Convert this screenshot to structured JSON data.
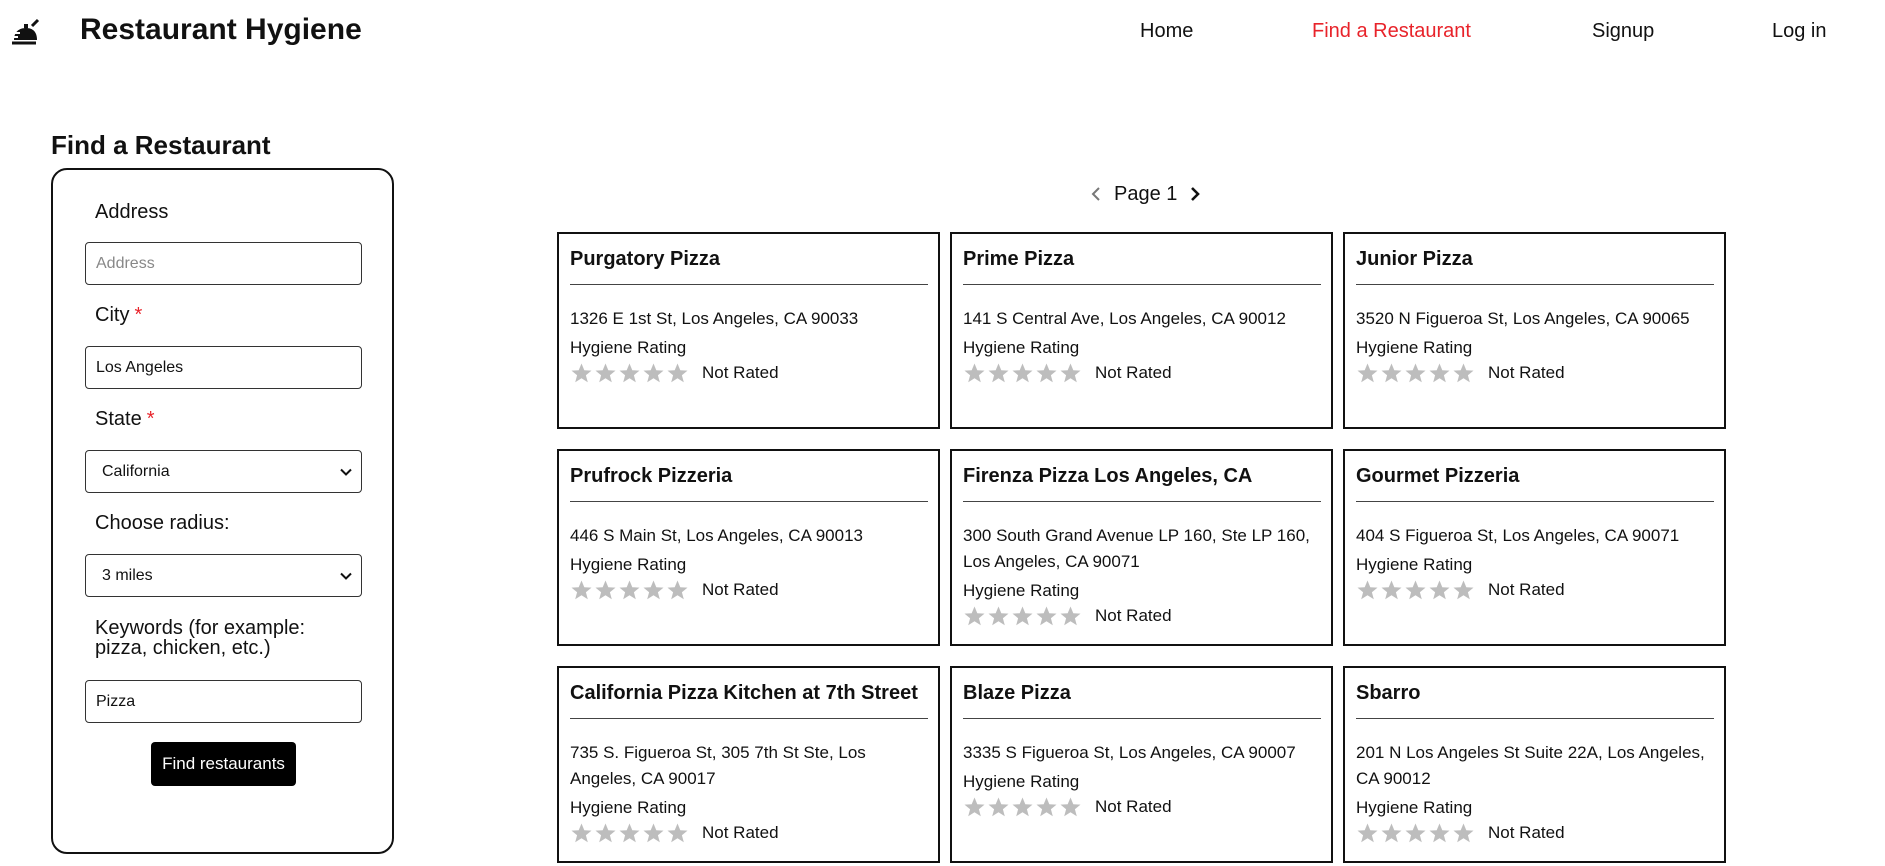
{
  "brand": {
    "title": "Restaurant Hygiene",
    "logo_icon": "restaurant-cloche-icon"
  },
  "nav": {
    "items": [
      {
        "label": "Home",
        "active": false
      },
      {
        "label": "Find a Restaurant",
        "active": true
      },
      {
        "label": "Signup",
        "active": false
      },
      {
        "label": "Log in",
        "active": false
      }
    ]
  },
  "colors": {
    "accent": "#e8232a",
    "text": "#111111",
    "star_empty": "#bdbdbd",
    "button_bg": "#000000"
  },
  "search": {
    "page_title": "Find a Restaurant",
    "address": {
      "label": "Address",
      "placeholder": "Address",
      "value": ""
    },
    "city": {
      "label": "City",
      "required_mark": "*",
      "value": "Los Angeles"
    },
    "state": {
      "label": "State",
      "required_mark": "*",
      "value": "California"
    },
    "radius": {
      "label": "Choose radius:",
      "value": "3 miles"
    },
    "keywords": {
      "label": "Keywords (for example: pizza, chicken, etc.)",
      "value": "Pizza"
    },
    "submit_label": "Find restaurants"
  },
  "pagination": {
    "label": "Page 1",
    "prev_icon": "chevron-left-icon",
    "next_icon": "chevron-right-icon"
  },
  "results": [
    {
      "name": "Purgatory Pizza",
      "address": "1326 E 1st St, Los Angeles, CA 90033",
      "rating_label": "Hygiene Rating",
      "stars": 0,
      "rating_text": "Not Rated"
    },
    {
      "name": "Prime Pizza",
      "address": "141 S Central Ave, Los Angeles, CA 90012",
      "rating_label": "Hygiene Rating",
      "stars": 0,
      "rating_text": "Not Rated"
    },
    {
      "name": "Junior Pizza",
      "address": "3520 N Figueroa St, Los Angeles, CA 90065",
      "rating_label": "Hygiene Rating",
      "stars": 0,
      "rating_text": "Not Rated"
    },
    {
      "name": "Prufrock Pizzeria",
      "address": "446 S Main St, Los Angeles, CA 90013",
      "rating_label": "Hygiene Rating",
      "stars": 0,
      "rating_text": "Not Rated"
    },
    {
      "name": "Firenza Pizza Los Angeles, CA",
      "address": "300 South Grand Avenue LP 160, Ste LP 160, Los Angeles, CA 90071",
      "rating_label": "Hygiene Rating",
      "stars": 0,
      "rating_text": "Not Rated"
    },
    {
      "name": "Gourmet Pizzeria",
      "address": "404 S Figueroa St, Los Angeles, CA 90071",
      "rating_label": "Hygiene Rating",
      "stars": 0,
      "rating_text": "Not Rated"
    },
    {
      "name": "California Pizza Kitchen at 7th Street",
      "address": "735 S. Figueroa St, 305 7th St Ste, Los Angeles, CA 90017",
      "rating_label": "Hygiene Rating",
      "stars": 0,
      "rating_text": "Not Rated"
    },
    {
      "name": "Blaze Pizza",
      "address": "3335 S Figueroa St, Los Angeles, CA 90007",
      "rating_label": "Hygiene Rating",
      "stars": 0,
      "rating_text": "Not Rated"
    },
    {
      "name": "Sbarro",
      "address": "201 N Los Angeles St Suite 22A, Los Angeles, CA 90012",
      "rating_label": "Hygiene Rating",
      "stars": 0,
      "rating_text": "Not Rated"
    }
  ]
}
